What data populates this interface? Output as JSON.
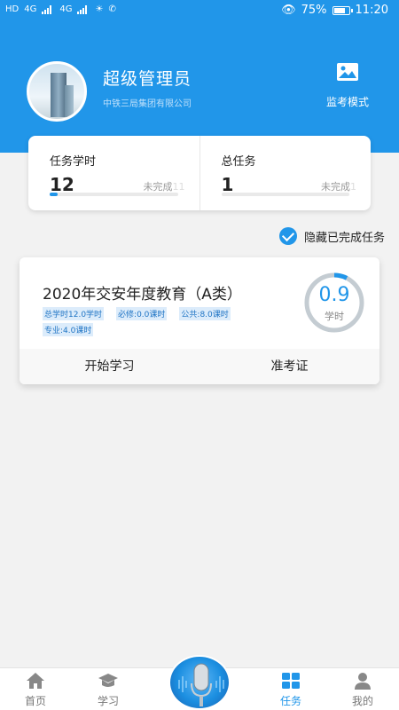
{
  "status_bar": {
    "left_indicators": [
      "HD",
      "4G",
      "4G"
    ],
    "battery_percent": "75%",
    "battery_level": 0.75,
    "time": "11:20"
  },
  "header": {
    "user_name": "超级管理员",
    "org_name": "中铁三局集团有限公司",
    "monitor_label": "监考模式",
    "monitor_icon": "image-icon",
    "background": "#2196e9"
  },
  "stats": [
    {
      "label": "任务学时",
      "value": "12",
      "sub_label": "未完成",
      "sub_value": "11",
      "progress": 0.06
    },
    {
      "label": "总任务",
      "value": "1",
      "sub_label": "未完成",
      "sub_value": "1",
      "progress": 0.0
    }
  ],
  "hide_completed": {
    "label": "隐藏已完成任务",
    "checked": true
  },
  "task": {
    "title": "2020年交安年度教育（A类）",
    "tags": [
      "总学时12.0学时",
      "必修:0.0课时",
      "公共:8.0课时",
      "专业:4.0课时"
    ],
    "ring_value": "0.9",
    "ring_unit": "学时",
    "ring_progress": 0.075,
    "actions": [
      "开始学习",
      "准考证"
    ]
  },
  "tabbar": {
    "tabs": [
      {
        "label": "首页",
        "icon": "home-icon"
      },
      {
        "label": "学习",
        "icon": "graduation-cap-icon"
      },
      {
        "label": "任务",
        "icon": "grid-icon",
        "active": true
      },
      {
        "label": "我的",
        "icon": "person-icon"
      }
    ],
    "center_icon": "microphone-icon"
  },
  "colors": {
    "accent": "#2196e9",
    "page_bg": "#f2f2f2"
  }
}
